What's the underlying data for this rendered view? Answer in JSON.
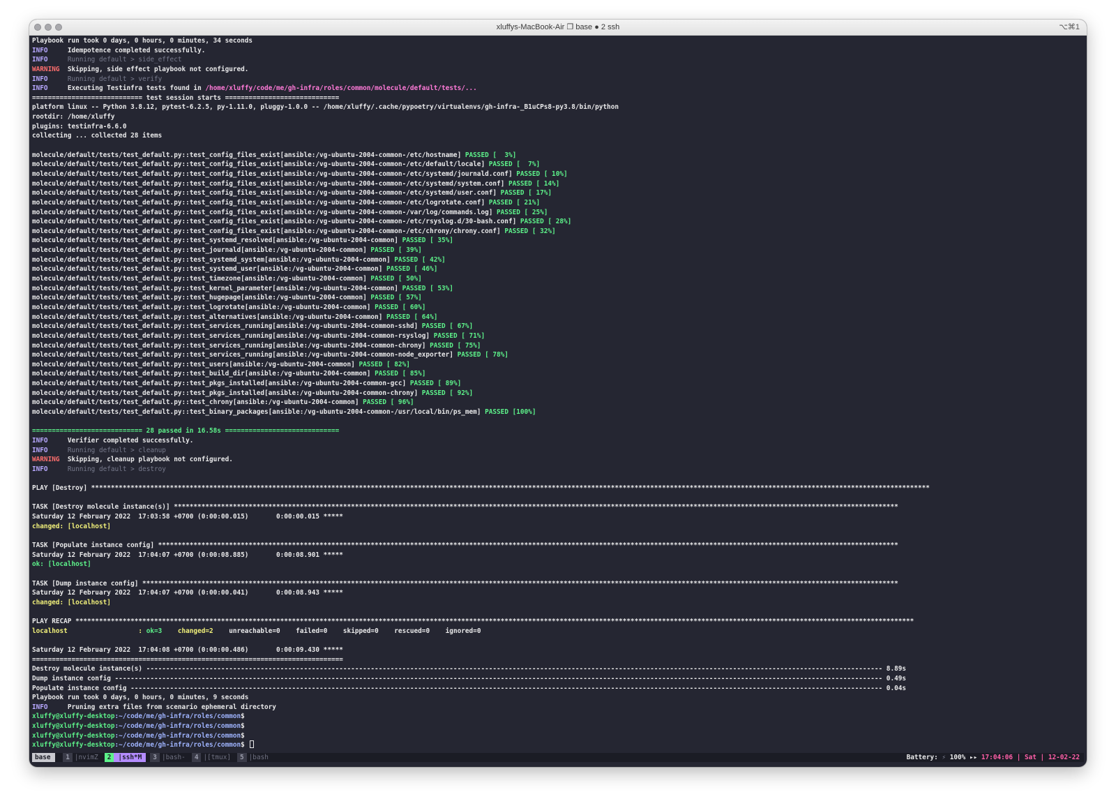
{
  "window": {
    "title": "xluffys-MacBook-Air ❐ base ● 2 ssh",
    "shortcut": "⌥⌘1"
  },
  "lines": [
    [
      {
        "t": "Playbook run took 0 days, 0 hours, 0 minutes, 34 seconds"
      }
    ],
    [
      {
        "t": "INFO     ",
        "c": "info"
      },
      {
        "t": "Idempotence completed successfully."
      }
    ],
    [
      {
        "t": "INFO     ",
        "c": "info"
      },
      {
        "t": "Running default > side_effect",
        "c": "dim"
      }
    ],
    [
      {
        "t": "WARNING  ",
        "c": "warn"
      },
      {
        "t": "Skipping, side effect playbook not configured."
      }
    ],
    [
      {
        "t": "INFO     ",
        "c": "info"
      },
      {
        "t": "Running default > verify",
        "c": "dim"
      }
    ],
    [
      {
        "t": "INFO     ",
        "c": "info"
      },
      {
        "t": "Executing Testinfra tests found in "
      },
      {
        "t": "/home/xluffy/code/me/gh-infra/roles/common/molecule/default/tests/...",
        "c": "path"
      }
    ],
    [
      {
        "t": "============================ test session starts ============================="
      }
    ],
    [
      {
        "t": "platform linux -- Python 3.8.12, pytest-6.2.5, py-1.11.0, pluggy-1.0.0 -- /home/xluffy/.cache/pypoetry/virtualenvs/gh-infra-_B1uCPs8-py3.8/bin/python"
      }
    ],
    [
      {
        "t": "rootdir: /home/xluffy"
      }
    ],
    [
      {
        "t": "plugins: testinfra-6.6.0"
      }
    ],
    [
      {
        "t": "collecting ... collected 28 items"
      }
    ],
    [
      {
        "t": ""
      }
    ],
    [
      {
        "t": "molecule/default/tests/test_default.py::test_config_files_exist[ansible:/vg-ubuntu-2004-common-/etc/hostname] "
      },
      {
        "t": "PASSED [  3%]",
        "c": "pass"
      }
    ],
    [
      {
        "t": "molecule/default/tests/test_default.py::test_config_files_exist[ansible:/vg-ubuntu-2004-common-/etc/default/locale] "
      },
      {
        "t": "PASSED [  7%]",
        "c": "pass"
      }
    ],
    [
      {
        "t": "molecule/default/tests/test_default.py::test_config_files_exist[ansible:/vg-ubuntu-2004-common-/etc/systemd/journald.conf] "
      },
      {
        "t": "PASSED [ 10%]",
        "c": "pass"
      }
    ],
    [
      {
        "t": "molecule/default/tests/test_default.py::test_config_files_exist[ansible:/vg-ubuntu-2004-common-/etc/systemd/system.conf] "
      },
      {
        "t": "PASSED [ 14%]",
        "c": "pass"
      }
    ],
    [
      {
        "t": "molecule/default/tests/test_default.py::test_config_files_exist[ansible:/vg-ubuntu-2004-common-/etc/systemd/user.conf] "
      },
      {
        "t": "PASSED [ 17%]",
        "c": "pass"
      }
    ],
    [
      {
        "t": "molecule/default/tests/test_default.py::test_config_files_exist[ansible:/vg-ubuntu-2004-common-/etc/logrotate.conf] "
      },
      {
        "t": "PASSED [ 21%]",
        "c": "pass"
      }
    ],
    [
      {
        "t": "molecule/default/tests/test_default.py::test_config_files_exist[ansible:/vg-ubuntu-2004-common-/var/log/commands.log] "
      },
      {
        "t": "PASSED [ 25%]",
        "c": "pass"
      }
    ],
    [
      {
        "t": "molecule/default/tests/test_default.py::test_config_files_exist[ansible:/vg-ubuntu-2004-common-/etc/rsyslog.d/30-bash.conf] "
      },
      {
        "t": "PASSED [ 28%]",
        "c": "pass"
      }
    ],
    [
      {
        "t": "molecule/default/tests/test_default.py::test_config_files_exist[ansible:/vg-ubuntu-2004-common-/etc/chrony/chrony.conf] "
      },
      {
        "t": "PASSED [ 32%]",
        "c": "pass"
      }
    ],
    [
      {
        "t": "molecule/default/tests/test_default.py::test_systemd_resolved[ansible:/vg-ubuntu-2004-common] "
      },
      {
        "t": "PASSED [ 35%]",
        "c": "pass"
      }
    ],
    [
      {
        "t": "molecule/default/tests/test_default.py::test_journald[ansible:/vg-ubuntu-2004-common] "
      },
      {
        "t": "PASSED [ 39%]",
        "c": "pass"
      }
    ],
    [
      {
        "t": "molecule/default/tests/test_default.py::test_systemd_system[ansible:/vg-ubuntu-2004-common] "
      },
      {
        "t": "PASSED [ 42%]",
        "c": "pass"
      }
    ],
    [
      {
        "t": "molecule/default/tests/test_default.py::test_systemd_user[ansible:/vg-ubuntu-2004-common] "
      },
      {
        "t": "PASSED [ 46%]",
        "c": "pass"
      }
    ],
    [
      {
        "t": "molecule/default/tests/test_default.py::test_timezone[ansible:/vg-ubuntu-2004-common] "
      },
      {
        "t": "PASSED [ 50%]",
        "c": "pass"
      }
    ],
    [
      {
        "t": "molecule/default/tests/test_default.py::test_kernel_parameter[ansible:/vg-ubuntu-2004-common] "
      },
      {
        "t": "PASSED [ 53%]",
        "c": "pass"
      }
    ],
    [
      {
        "t": "molecule/default/tests/test_default.py::test_hugepage[ansible:/vg-ubuntu-2004-common] "
      },
      {
        "t": "PASSED [ 57%]",
        "c": "pass"
      }
    ],
    [
      {
        "t": "molecule/default/tests/test_default.py::test_logrotate[ansible:/vg-ubuntu-2004-common] "
      },
      {
        "t": "PASSED [ 60%]",
        "c": "pass"
      }
    ],
    [
      {
        "t": "molecule/default/tests/test_default.py::test_alternatives[ansible:/vg-ubuntu-2004-common] "
      },
      {
        "t": "PASSED [ 64%]",
        "c": "pass"
      }
    ],
    [
      {
        "t": "molecule/default/tests/test_default.py::test_services_running[ansible:/vg-ubuntu-2004-common-sshd] "
      },
      {
        "t": "PASSED [ 67%]",
        "c": "pass"
      }
    ],
    [
      {
        "t": "molecule/default/tests/test_default.py::test_services_running[ansible:/vg-ubuntu-2004-common-rsyslog] "
      },
      {
        "t": "PASSED [ 71%]",
        "c": "pass"
      }
    ],
    [
      {
        "t": "molecule/default/tests/test_default.py::test_services_running[ansible:/vg-ubuntu-2004-common-chrony] "
      },
      {
        "t": "PASSED [ 75%]",
        "c": "pass"
      }
    ],
    [
      {
        "t": "molecule/default/tests/test_default.py::test_services_running[ansible:/vg-ubuntu-2004-common-node_exporter] "
      },
      {
        "t": "PASSED [ 78%]",
        "c": "pass"
      }
    ],
    [
      {
        "t": "molecule/default/tests/test_default.py::test_users[ansible:/vg-ubuntu-2004-common] "
      },
      {
        "t": "PASSED [ 82%]",
        "c": "pass"
      }
    ],
    [
      {
        "t": "molecule/default/tests/test_default.py::test_build_dir[ansible:/vg-ubuntu-2004-common] "
      },
      {
        "t": "PASSED [ 85%]",
        "c": "pass"
      }
    ],
    [
      {
        "t": "molecule/default/tests/test_default.py::test_pkgs_installed[ansible:/vg-ubuntu-2004-common-gcc] "
      },
      {
        "t": "PASSED [ 89%]",
        "c": "pass"
      }
    ],
    [
      {
        "t": "molecule/default/tests/test_default.py::test_pkgs_installed[ansible:/vg-ubuntu-2004-common-chrony] "
      },
      {
        "t": "PASSED [ 92%]",
        "c": "pass"
      }
    ],
    [
      {
        "t": "molecule/default/tests/test_default.py::test_chrony[ansible:/vg-ubuntu-2004-common] "
      },
      {
        "t": "PASSED [ 96%]",
        "c": "pass"
      }
    ],
    [
      {
        "t": "molecule/default/tests/test_default.py::test_binary_packages[ansible:/vg-ubuntu-2004-common-/usr/local/bin/ps_mem] "
      },
      {
        "t": "PASSED [100%]",
        "c": "pass"
      }
    ],
    [
      {
        "t": ""
      }
    ],
    [
      {
        "t": "============================ 28 passed in 16.58s =============================",
        "c": "grn"
      }
    ],
    [
      {
        "t": "INFO     ",
        "c": "info"
      },
      {
        "t": "Verifier completed successfully."
      }
    ],
    [
      {
        "t": "INFO     ",
        "c": "info"
      },
      {
        "t": "Running default > cleanup",
        "c": "dim"
      }
    ],
    [
      {
        "t": "WARNING  ",
        "c": "warn"
      },
      {
        "t": "Skipping, cleanup playbook not configured."
      }
    ],
    [
      {
        "t": "INFO     ",
        "c": "info"
      },
      {
        "t": "Running default > destroy",
        "c": "dim"
      }
    ],
    [
      {
        "t": ""
      }
    ],
    [
      {
        "t": "PLAY [Destroy] *********************************************************************************************************************************************************************************************************************"
      }
    ],
    [
      {
        "t": ""
      }
    ],
    [
      {
        "t": "TASK [Destroy molecule instance(s)] ****************************************************************************************************************************************************************************************"
      }
    ],
    [
      {
        "t": "Saturday 12 February 2022  17:03:58 +0700 (0:00:00.015)       0:00:00.015 *****"
      }
    ],
    [
      {
        "t": "changed: [localhost]",
        "c": "yel"
      }
    ],
    [
      {
        "t": ""
      }
    ],
    [
      {
        "t": "TASK [Populate instance config] ********************************************************************************************************************************************************************************************"
      }
    ],
    [
      {
        "t": "Saturday 12 February 2022  17:04:07 +0700 (0:00:08.885)       0:00:08.901 *****"
      }
    ],
    [
      {
        "t": "ok: [localhost]",
        "c": "grn"
      }
    ],
    [
      {
        "t": ""
      }
    ],
    [
      {
        "t": "TASK [Dump instance config] ************************************************************************************************************************************************************************************************"
      }
    ],
    [
      {
        "t": "Saturday 12 February 2022  17:04:07 +0700 (0:00:00.041)       0:00:08.943 *****"
      }
    ],
    [
      {
        "t": "changed: [localhost]",
        "c": "yel"
      }
    ],
    [
      {
        "t": ""
      }
    ],
    [
      {
        "t": "PLAY RECAP *********************************************************************************************************************************************************************************************************************"
      }
    ],
    [
      {
        "t": "localhost                  : ",
        "c": "yel"
      },
      {
        "t": "ok=3",
        "c": "grn"
      },
      {
        "t": "    "
      },
      {
        "t": "changed=2",
        "c": "yel"
      },
      {
        "t": "    unreachable=0    failed=0    skipped=0    rescued=0    ignored=0"
      }
    ],
    [
      {
        "t": ""
      }
    ],
    [
      {
        "t": "Saturday 12 February 2022  17:04:08 +0700 (0:00:00.486)       0:00:09.430 *****"
      }
    ],
    [
      {
        "t": "==============================================================================="
      }
    ],
    [
      {
        "t": "Destroy molecule instance(s) ------------------------------------------------------------------------------------------------------------------------------------------------------------------------------------------- 8.89s"
      }
    ],
    [
      {
        "t": "Dump instance config --------------------------------------------------------------------------------------------------------------------------------------------------------------------------------------------------- 0.49s"
      }
    ],
    [
      {
        "t": "Populate instance config ----------------------------------------------------------------------------------------------------------------------------------------------------------------------------------------------- 0.04s"
      }
    ],
    [
      {
        "t": "Playbook run took 0 days, 0 hours, 0 minutes, 9 seconds"
      }
    ],
    [
      {
        "t": "INFO     ",
        "c": "info"
      },
      {
        "t": "Pruning extra files from scenario ephemeral directory"
      }
    ],
    [
      {
        "t": "xluffy@xluffy-desktop",
        "c": "prompt"
      },
      {
        "t": ":~/code/me/gh-infra/roles/common",
        "c": "cwd"
      },
      {
        "t": "$"
      }
    ],
    [
      {
        "t": "xluffy@xluffy-desktop",
        "c": "prompt"
      },
      {
        "t": ":~/code/me/gh-infra/roles/common",
        "c": "cwd"
      },
      {
        "t": "$"
      }
    ],
    [
      {
        "t": "xluffy@xluffy-desktop",
        "c": "prompt"
      },
      {
        "t": ":~/code/me/gh-infra/roles/common",
        "c": "cwd"
      },
      {
        "t": "$"
      }
    ],
    [
      {
        "t": "xluffy@xluffy-desktop",
        "c": "prompt"
      },
      {
        "t": ":~/code/me/gh-infra/roles/common",
        "c": "cwd"
      },
      {
        "t": "$ "
      },
      {
        "t": "",
        "c": "cursor"
      }
    ]
  ],
  "status_bar": {
    "session": "base",
    "windows": [
      {
        "num": "1",
        "label": "|nvimZ",
        "active": false
      },
      {
        "num": "2",
        "label": "|ssh*M",
        "active": true
      },
      {
        "num": "3",
        "label": "|bash-",
        "active": false
      },
      {
        "num": "4",
        "label": "|[tmux]",
        "active": false
      },
      {
        "num": "5",
        "label": "|bash",
        "active": false
      }
    ],
    "battery_label": "Battery: ",
    "battery_icon": "⚡",
    "battery": " 100% ▸▸ ",
    "clock": "17:04:06 | Sat | 12-02-22"
  },
  "colors": {
    "background": "#252632",
    "info": "#b8a8ff",
    "warning": "#ff6e6e",
    "passed": "#5df28a",
    "path": "#ff7ad8",
    "changed": "#f1f07a"
  }
}
